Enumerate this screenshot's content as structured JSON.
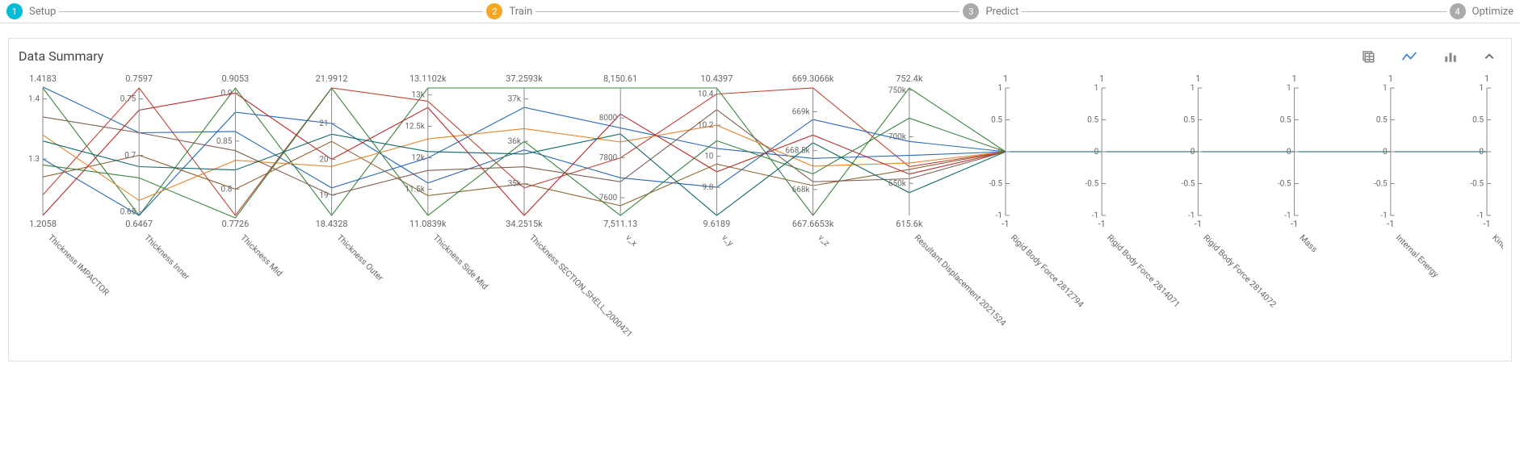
{
  "stepper": {
    "steps": [
      {
        "num": "1",
        "label": "Setup",
        "class": "badge-setup"
      },
      {
        "num": "2",
        "label": "Train",
        "class": "badge-train"
      },
      {
        "num": "3",
        "label": "Predict",
        "class": "badge-predict"
      },
      {
        "num": "4",
        "label": "Optimize",
        "class": "badge-optimize"
      }
    ]
  },
  "panel": {
    "title": "Data Summary"
  },
  "colors": {
    "accent_blue": "#3a7de0",
    "line_colors": [
      "#c0392b",
      "#2e7d32",
      "#1a5fb4",
      "#8a5d2a",
      "#e67e22",
      "#1abc9c"
    ]
  },
  "chart_data": {
    "type": "parallel-coordinates",
    "axes": [
      {
        "name": "Thickness IMPACTOR",
        "top": "1.4183",
        "bottom": "1.2058",
        "ticks": [
          "1.4",
          "1.3"
        ],
        "min": 1.2058,
        "max": 1.4183
      },
      {
        "name": "Thickness Inner",
        "top": "0.7597",
        "bottom": "0.6467",
        "ticks": [
          "0.75",
          "0.7",
          "0.65"
        ],
        "min": 0.6467,
        "max": 0.7597
      },
      {
        "name": "Thickness Mid",
        "top": "0.9053",
        "bottom": "0.7726",
        "ticks": [
          "0.9",
          "0.85",
          "0.8"
        ],
        "min": 0.7726,
        "max": 0.9053
      },
      {
        "name": "Thickness Outer",
        "top": "21.9912",
        "bottom": "18.4328",
        "ticks": [
          "21",
          "20",
          "19"
        ],
        "min": 18.4328,
        "max": 21.9912
      },
      {
        "name": "Thickness Side Mid",
        "top": "13.1102k",
        "bottom": "11.0839k",
        "ticks": [
          "13k",
          "12.5k",
          "12k",
          "11.5k"
        ],
        "min": 11083.9,
        "max": 13110.2
      },
      {
        "name": "Thickness SECTION_SHELL_2000421",
        "top": "37.2593k",
        "bottom": "34.2515k",
        "ticks": [
          "37k",
          "36k",
          "35k"
        ],
        "min": 34251.5,
        "max": 37259.3
      },
      {
        "name": "v_x",
        "top": "8,150.61",
        "bottom": "7,511.13",
        "ticks": [
          "8000",
          "7800",
          "7600"
        ],
        "min": 7511.13,
        "max": 8150.61
      },
      {
        "name": "v_y",
        "top": "10.4397",
        "bottom": "9.6189",
        "ticks": [
          "10.4",
          "10.2",
          "10",
          "9.8"
        ],
        "min": 9.6189,
        "max": 10.4397
      },
      {
        "name": "v_z",
        "top": "669.3066k",
        "bottom": "667.6653k",
        "ticks": [
          "669k",
          "668.5k",
          "668k"
        ],
        "min": 667665.3,
        "max": 669306.6
      },
      {
        "name": "Resultant Displacement 2021524",
        "top": "752.4k",
        "bottom": "615.6k",
        "ticks": [
          "750k",
          "700k",
          "650k"
        ],
        "min": 615600,
        "max": 752400
      },
      {
        "name": "Rigid Body Force 2812794",
        "top": "1",
        "bottom": "-1",
        "ticks": [
          "1",
          "0.5",
          "0",
          "-0.5",
          "-1"
        ],
        "min": -1,
        "max": 1
      },
      {
        "name": "Rigid Body Force 2814071",
        "top": "1",
        "bottom": "-1",
        "ticks": [
          "1",
          "0.5",
          "0",
          "-0.5",
          "-1"
        ],
        "min": -1,
        "max": 1
      },
      {
        "name": "Rigid Body Force 2814072",
        "top": "1",
        "bottom": "-1",
        "ticks": [
          "1",
          "0.5",
          "0",
          "-0.5",
          "-1"
        ],
        "min": -1,
        "max": 1
      },
      {
        "name": "Mass",
        "top": "1",
        "bottom": "-1",
        "ticks": [
          "1",
          "0.5",
          "0",
          "-0.5",
          "-1"
        ],
        "min": -1,
        "max": 1
      },
      {
        "name": "Internal Energy",
        "top": "1",
        "bottom": "-1",
        "ticks": [
          "1",
          "0.5",
          "0",
          "-0.5",
          "-1"
        ],
        "min": -1,
        "max": 1
      },
      {
        "name": "Kinetic Energy",
        "top": "1",
        "bottom": "-1",
        "ticks": [
          "1",
          "0.5",
          "0",
          "-0.5",
          "-1"
        ],
        "min": -1,
        "max": 1
      }
    ],
    "tick_numeric": {
      "Thickness IMPACTOR": [
        1.4,
        1.3
      ],
      "Thickness Inner": [
        0.75,
        0.7,
        0.65
      ],
      "Thickness Mid": [
        0.9,
        0.85,
        0.8
      ],
      "Thickness Outer": [
        21,
        20,
        19
      ],
      "Thickness Side Mid": [
        13000,
        12500,
        12000,
        11500
      ],
      "Thickness SECTION_SHELL_2000421": [
        37000,
        36000,
        35000
      ],
      "v_x": [
        8000,
        7800,
        7600
      ],
      "v_y": [
        10.4,
        10.2,
        10,
        9.8
      ],
      "v_z": [
        669000,
        668500,
        668000
      ],
      "Resultant Displacement 2021524": [
        750000,
        700000,
        650000
      ],
      "Rigid Body Force 2812794": [
        1,
        0.5,
        0,
        -0.5,
        -1
      ],
      "Rigid Body Force 2814071": [
        1,
        0.5,
        0,
        -0.5,
        -1
      ],
      "Rigid Body Force 2814072": [
        1,
        0.5,
        0,
        -0.5,
        -1
      ],
      "Mass": [
        1,
        0.5,
        0,
        -0.5,
        -1
      ],
      "Internal Energy": [
        1,
        0.5,
        0,
        -0.5,
        -1
      ],
      "Kinetic Energy": [
        1,
        0.5,
        0,
        -0.5,
        -1
      ]
    },
    "series": [
      {
        "color": "#2e7d32",
        "values": [
          1.4183,
          0.6467,
          0.9053,
          18.4328,
          13110.2,
          37259.3,
          8150.61,
          10.4397,
          667665.3,
          752400,
          0,
          0,
          0,
          0,
          0,
          0
        ]
      },
      {
        "color": "#c0392b",
        "values": [
          1.24,
          0.7597,
          0.7726,
          21.9912,
          12900,
          34900,
          7800,
          10.4,
          669306.6,
          668000,
          0,
          0,
          0,
          0,
          0,
          0
        ]
      },
      {
        "color": "#1a5fb4",
        "values": [
          1.42,
          0.72,
          0.86,
          19.2,
          12000,
          36800,
          7950,
          10.05,
          668400,
          680000,
          0,
          0,
          0,
          0,
          0,
          0
        ]
      },
      {
        "color": "#1a5fb4",
        "values": [
          1.3,
          0.6467,
          0.88,
          21.0,
          11600,
          35800,
          7700,
          9.8,
          668900,
          695000,
          0,
          0,
          0,
          0,
          0,
          0
        ]
      },
      {
        "color": "#8a5d2a",
        "values": [
          1.27,
          0.7,
          0.8,
          20.5,
          11400,
          35000,
          7560,
          9.95,
          668050,
          665000,
          0,
          0,
          0,
          0,
          0,
          0
        ]
      },
      {
        "color": "#e67e22",
        "values": [
          1.34,
          0.66,
          0.83,
          19.8,
          12300,
          36300,
          7880,
          10.2,
          668300,
          672000,
          0,
          0,
          0,
          0,
          0,
          0
        ]
      },
      {
        "color": "#b71c1c",
        "values": [
          1.2058,
          0.74,
          0.9,
          20.0,
          12800,
          34251.5,
          8020,
          9.9,
          668700,
          660000,
          0,
          0,
          0,
          0,
          0,
          0
        ]
      },
      {
        "color": "#2e7d32",
        "values": [
          1.29,
          0.68,
          0.77,
          21.99,
          11083.9,
          36000,
          7511.13,
          10.1,
          668200,
          720000,
          0,
          0,
          0,
          0,
          0,
          0
        ]
      },
      {
        "color": "#795548",
        "values": [
          1.37,
          0.72,
          0.84,
          19.0,
          11800,
          35400,
          7680,
          10.3,
          668100,
          655000,
          0,
          0,
          0,
          0,
          0,
          0
        ]
      },
      {
        "color": "#006064",
        "values": [
          1.33,
          0.69,
          0.82,
          20.7,
          12100,
          35700,
          7920,
          9.6189,
          668600,
          640000,
          0,
          0,
          0,
          0,
          0,
          0
        ]
      }
    ]
  }
}
